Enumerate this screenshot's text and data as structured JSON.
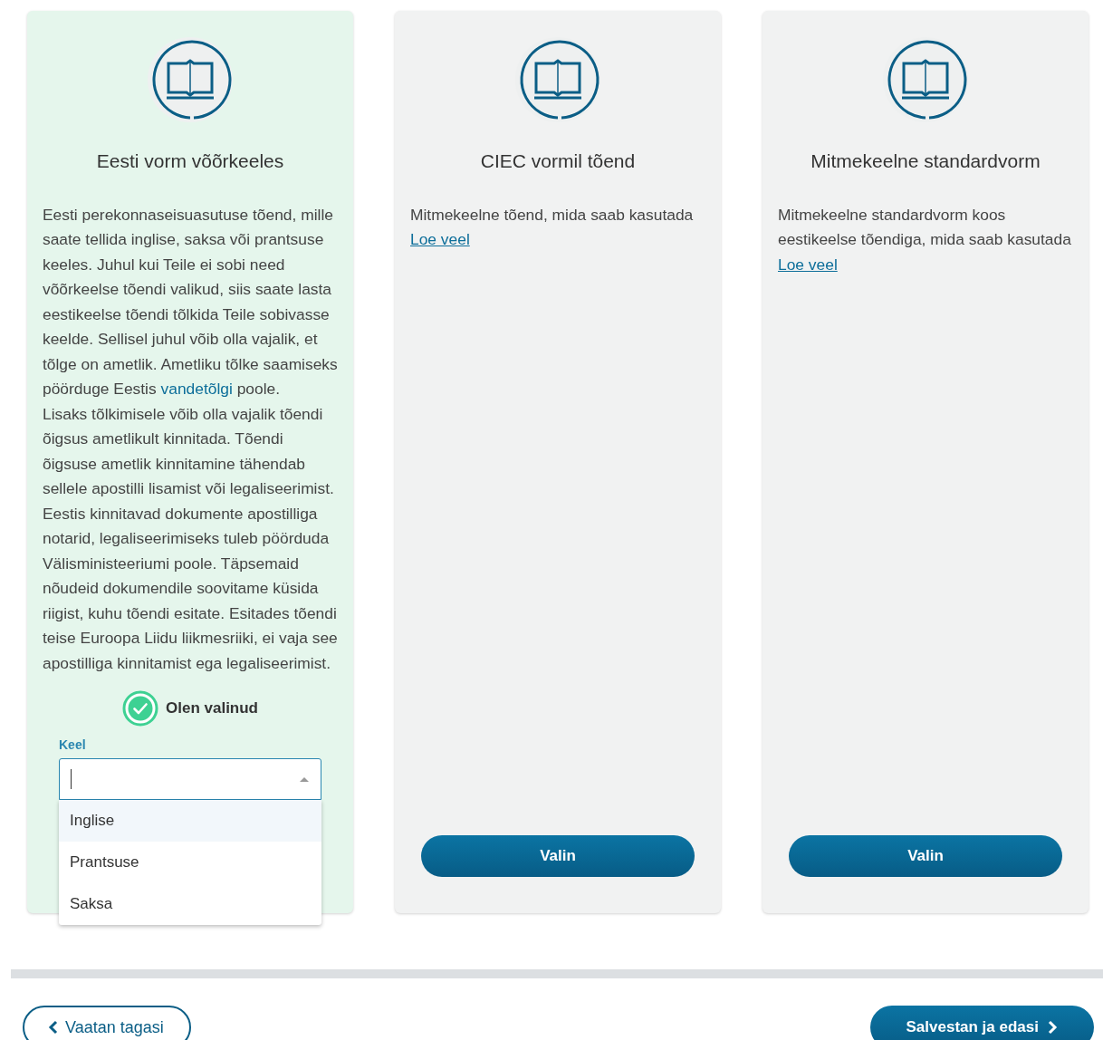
{
  "options": [
    {
      "title": "Eesti vorm võõrkeeles",
      "selected": true,
      "description": [
        [
          {
            "kind": "text",
            "text": "Eesti perekonnaseisuasutuse tõend, mille saate tellida inglise, saksa või prantsuse keeles. Juhul kui Teile ei sobi need võõrkeelse tõendi valikud, siis saate lasta eestikeelse tõendi tõlkida Teile sobivasse keelde. Sellisel juhul võib olla vajalik, et tõlge on ametlik. Ametliku tõlke saamiseks pöörduge Eestis "
          },
          {
            "kind": "plain-link",
            "text": "vandetõlgi"
          },
          {
            "kind": "text",
            "text": " poole."
          }
        ],
        [
          {
            "kind": "text",
            "text": "Lisaks tõlkimisele võib olla vajalik tõendi õigsus ametlikult kinnitada. Tõendi õigsuse ametlik kinnitamine tähendab sellele apostilli lisamist või legaliseerimist. Eestis kinnitavad dokumente apostilliga notarid, legaliseerimiseks tuleb pöörduda Välisministeeriumi poole. Täpsemaid nõudeid dokumendile soovitame küsida riigist, kuhu tõendi esitate. Esitades tõendi teise Euroopa Liidu liikmesriiki, ei vaja see apostilliga kinnitamist ega legaliseerimist."
          }
        ]
      ],
      "status_label": "Olen valinud",
      "field": {
        "label": "Keel",
        "focused": true,
        "expanded": true,
        "options": [
          {
            "text": "Inglise",
            "selected": true
          },
          {
            "text": "Prantsuse",
            "selected": false
          },
          {
            "text": "Saksa",
            "selected": false
          }
        ]
      }
    },
    {
      "title": "CIEC vormil tõend",
      "selected": false,
      "description": [
        [
          {
            "kind": "text",
            "text": "Mitmekeelne tõend, mida saab kasutada "
          },
          {
            "kind": "underlined-link",
            "text": "Loe veel"
          }
        ]
      ],
      "button": "Valin"
    },
    {
      "title": "Mitmekeelne standardvorm",
      "selected": false,
      "description": [
        [
          {
            "kind": "text",
            "text": "Mitmekeelne standardvorm koos eestikeelse tõendiga, mida saab kasutada "
          },
          {
            "kind": "underlined-link",
            "text": "Loe veel"
          }
        ]
      ],
      "button": "Valin"
    }
  ],
  "back_button": "Vaatan tagasi",
  "next_button": "Salvestan ja edasi"
}
